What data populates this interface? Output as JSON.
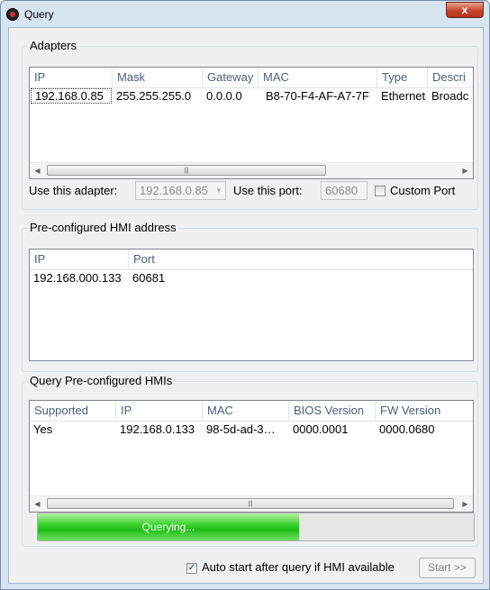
{
  "window": {
    "title": "Query",
    "close_glyph": "x"
  },
  "adapters": {
    "group_title": "Adapters",
    "columns": [
      "IP",
      "Mask",
      "Gateway",
      "MAC",
      "Type",
      "Descri"
    ],
    "rows": [
      [
        "192.168.0.85",
        "255.255.255.0",
        "0.0.0.0",
        "B8-70-F4-AF-A7-7F",
        "Ethernet",
        "Broadc"
      ]
    ],
    "use_adapter_label": "Use this adapter:",
    "adapter_value": "192.168.0.85",
    "use_port_label": "Use this port:",
    "port_value": "60680",
    "custom_port_label": "Custom Port",
    "custom_port_checked": false
  },
  "preconfigured": {
    "group_title": "Pre-configured HMI address",
    "columns": [
      "IP",
      "Port"
    ],
    "rows": [
      [
        "192.168.000.133",
        "60681"
      ]
    ]
  },
  "query": {
    "group_title": "Query Pre-configured HMIs",
    "columns": [
      "Supported",
      "IP",
      "MAC",
      "BIOS Version",
      "FW Version"
    ],
    "rows": [
      [
        "Yes",
        "192.168.0.133",
        "98-5d-ad-3…",
        "0000.0001",
        "0000.0680"
      ]
    ],
    "progress_label": "Querying...",
    "progress_fraction": 0.6
  },
  "footer": {
    "auto_start_label": "Auto start after query if HMI available",
    "auto_start_checked": true,
    "start_button_label": "Start >>"
  },
  "scroll_grip": "|||",
  "colors": {
    "progress_fill": "#1dbb16",
    "close_button": "#c7452f"
  }
}
